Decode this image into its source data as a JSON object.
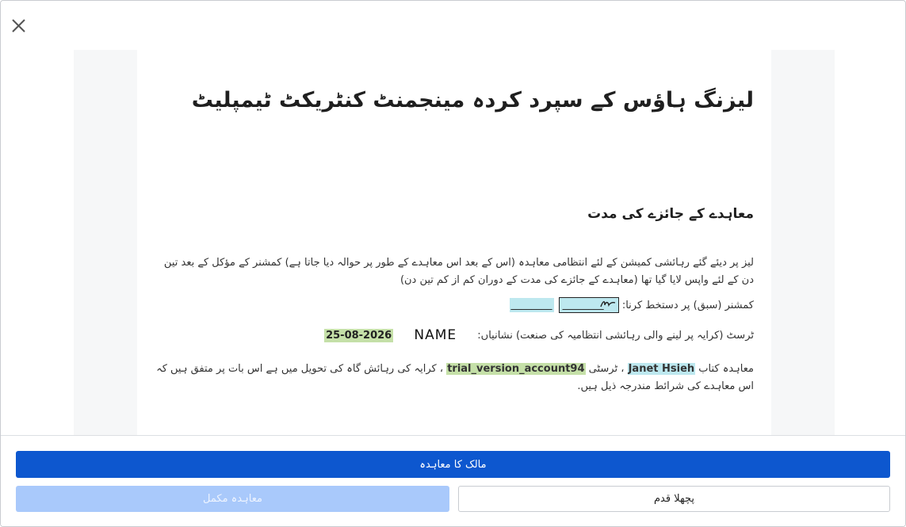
{
  "dialog": {
    "close_icon": "close-icon"
  },
  "document": {
    "title": "لیزنگ ہاؤس کے سپرد کردہ مینجمنٹ کنٹریکٹ ٹیمپلیٹ",
    "section_title": "معاہدے کے جائزے کی مدت",
    "paragraph1": "لیز پر دیئے گئے رہائشی کمیشن کے لئے انتظامی معاہدہ (اس کے بعد اس معاہدے کے طور پر حوالہ دیا جاتا ہے) کمشنر کے مؤکل کے بعد تین دن کے لئے واپس لایا گیا تھا (معاہدے کے جائزے کی مدت کے دوران کم از کم تین دن)",
    "commissioner_label": "کمشنر (سبق) پر دستخط کرنا:",
    "commissioner_blank1": "________",
    "commissioner_blank2": "________",
    "trust_label": "ٹرسٹ (کرایہ پر لینے والی رہائشی انتظامیہ کی صنعت) نشانیاں:",
    "name_field": "NAME",
    "date_field": "25-08-2026",
    "p3_part1": "معاہدہ کتاب",
    "p3_name1": "Janet Hsieh",
    "p3_part2": "، ٹرسٹی",
    "p3_name2": "trial_version_account94",
    "p3_part3": "، کرایہ کی رہائش گاہ کی تحویل میں ہے اس بات پر متفق ہیں کہ اس معاہدے کی شرائط مندرجہ ذیل ہیں."
  },
  "buttons": {
    "owner_agreement": "مالک کا معاہدہ",
    "complete_agreement": "معاہدہ مکمل",
    "previous_step": "پچھلا قدم"
  },
  "colors": {
    "primary": "#0d57cf",
    "primary_disabled": "#a9c9fb",
    "highlight_blue": "#bde8ef",
    "highlight_green": "#c5e0a8"
  }
}
